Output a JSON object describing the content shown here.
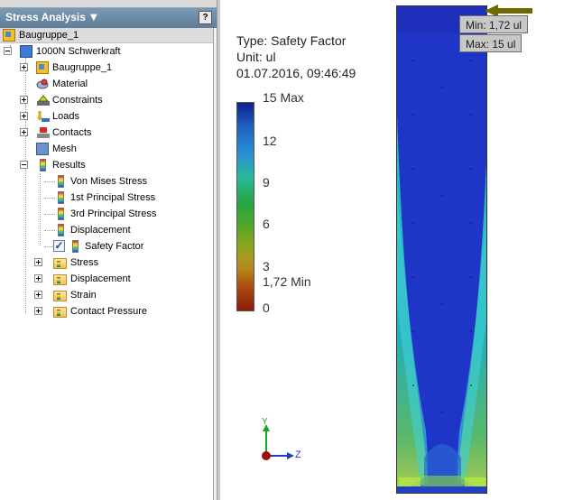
{
  "browser": {
    "title": "Stress Analysis",
    "help_label": "?",
    "root": "Baugruppe_1",
    "tree": [
      {
        "label": "1000N Schwerkraft"
      },
      {
        "label": "Baugruppe_1"
      },
      {
        "label": "Material"
      },
      {
        "label": "Constraints"
      },
      {
        "label": "Loads"
      },
      {
        "label": "Contacts"
      },
      {
        "label": "Mesh"
      },
      {
        "label": "Results"
      },
      {
        "label": "Von Mises Stress"
      },
      {
        "label": "1st Principal Stress"
      },
      {
        "label": "3rd Principal Stress"
      },
      {
        "label": "Displacement"
      },
      {
        "label": "Safety Factor",
        "checked": true
      },
      {
        "label": "Stress"
      },
      {
        "label": "Displacement"
      },
      {
        "label": "Strain"
      },
      {
        "label": "Contact Pressure"
      }
    ]
  },
  "result_info": {
    "type": "Type: Safety Factor",
    "unit": "Unit: ul",
    "timestamp": "01.07.2016, 09:46:49"
  },
  "legend": {
    "max_label": "15 Max",
    "ticks": [
      "12",
      "9",
      "6",
      "3"
    ],
    "min_label": "1,72 Min",
    "zero_label": "0"
  },
  "probes": {
    "min": "Min: 1,72 ul",
    "max": "Max: 15 ul"
  },
  "triad": {
    "y": "Y",
    "z": "Z"
  },
  "colors": {
    "model_fill": "#1f35c8",
    "header": "#6b88a3"
  }
}
